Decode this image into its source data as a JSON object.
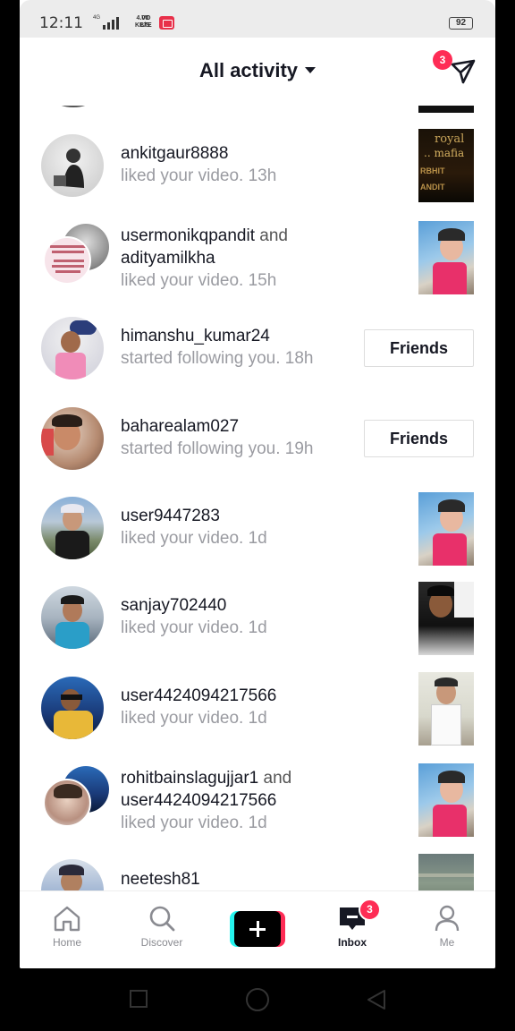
{
  "status_bar": {
    "time": "12:11",
    "network_tag": "4G",
    "speed_value": "4.00",
    "speed_unit": "KB/S",
    "volte_top": "VO",
    "volte_bottom": "LTE",
    "battery": "92"
  },
  "header": {
    "title": "All activity",
    "send_badge": "3"
  },
  "activities": [
    {
      "type": "like",
      "username": "ankitgaur8888",
      "text": "liked your video.",
      "time": "13h",
      "thumb_text": [
        "royal",
        ".. mafia",
        "RBHIT",
        "ANDIT"
      ]
    },
    {
      "type": "like_multi",
      "username": "usermonikqpandit",
      "joiner": "and",
      "username2": "adityamilkha",
      "text": "liked your video.",
      "time": "15h"
    },
    {
      "type": "follow",
      "username": "himanshu_kumar24",
      "text": "started following you.",
      "time": "18h",
      "button": "Friends"
    },
    {
      "type": "follow",
      "username": "baharealam027",
      "text": "started following you.",
      "time": "19h",
      "button": "Friends"
    },
    {
      "type": "like",
      "username": "user9447283",
      "text": "liked your video.",
      "time": "1d"
    },
    {
      "type": "like",
      "username": "sanjay702440",
      "text": "liked your video.",
      "time": "1d"
    },
    {
      "type": "like",
      "username": "user4424094217566",
      "text": "liked your video.",
      "time": "1d"
    },
    {
      "type": "like_multi",
      "username": "rohitbainslagujjar1",
      "joiner": "and",
      "username2": "user4424094217566",
      "text": "liked your video.",
      "time": "1d"
    },
    {
      "type": "like",
      "username": "neetesh81"
    }
  ],
  "nav": {
    "home": "Home",
    "discover": "Discover",
    "inbox": "Inbox",
    "inbox_badge": "3",
    "me": "Me"
  },
  "colors": {
    "accent": "#fe2c55",
    "cyan": "#25f4ee",
    "text": "#161823",
    "muted": "#9a9ba1"
  }
}
